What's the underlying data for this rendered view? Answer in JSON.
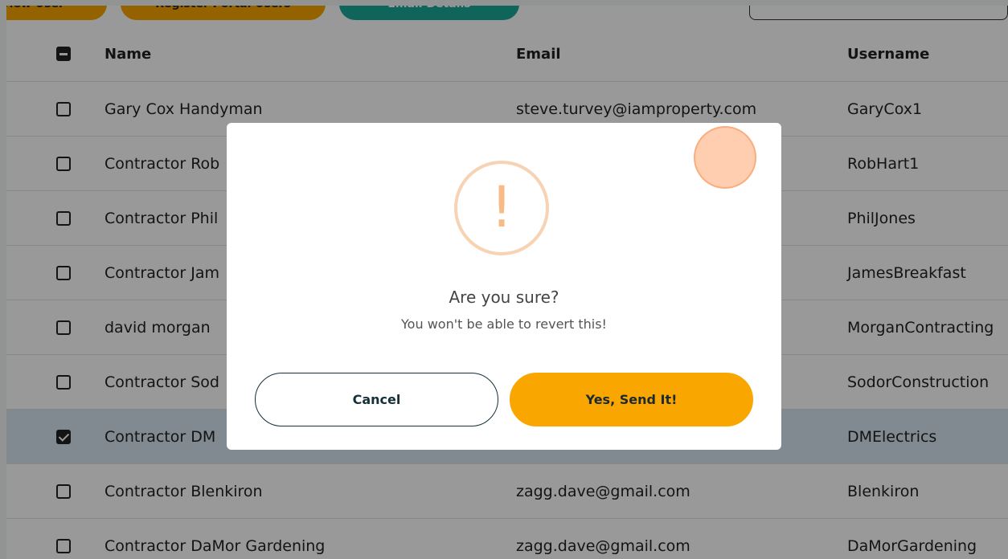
{
  "toolbar": {
    "buttons": [
      {
        "label": "View User",
        "color": "#f7a600"
      },
      {
        "label": "Register Portal Users",
        "color": "#f7a600"
      },
      {
        "label": "Email Details",
        "color": "#19a89a"
      }
    ]
  },
  "table": {
    "columns": [
      "Name",
      "Email",
      "Username"
    ],
    "rows": [
      {
        "name": "Gary Cox Handyman",
        "email": "steve.turvey@iamproperty.com",
        "username": "GaryCox1",
        "checked": false
      },
      {
        "name": "Contractor Rob",
        "email": "",
        "username": "RobHart1",
        "checked": false
      },
      {
        "name": "Contractor Phil",
        "email": "",
        "username": "PhilJones",
        "checked": false
      },
      {
        "name": "Contractor Jam",
        "email": "",
        "username": "JamesBreakfast",
        "checked": false
      },
      {
        "name": "david morgan",
        "email": "",
        "username": "MorganContracting",
        "checked": false
      },
      {
        "name": "Contractor Sod",
        "email": "",
        "username": "SodorConstruction",
        "checked": false
      },
      {
        "name": "Contractor DM",
        "email": "",
        "username": "DMElectrics",
        "checked": true
      },
      {
        "name": "Contractor Blenkiron",
        "email": "zagg.dave@gmail.com",
        "username": "Blenkiron",
        "checked": false
      },
      {
        "name": "Contractor DaMor Gardening",
        "email": "zagg.dave@gmail.com",
        "username": "DaMorGardening",
        "checked": false
      }
    ]
  },
  "dialog": {
    "icon": "warning-icon",
    "icon_glyph": "!",
    "title": "Are you sure?",
    "text": "You won't be able to revert this!",
    "cancel_label": "Cancel",
    "confirm_label": "Yes, Send It!",
    "accent_color": "#f9a600",
    "warning_color": "#f8bb86"
  }
}
